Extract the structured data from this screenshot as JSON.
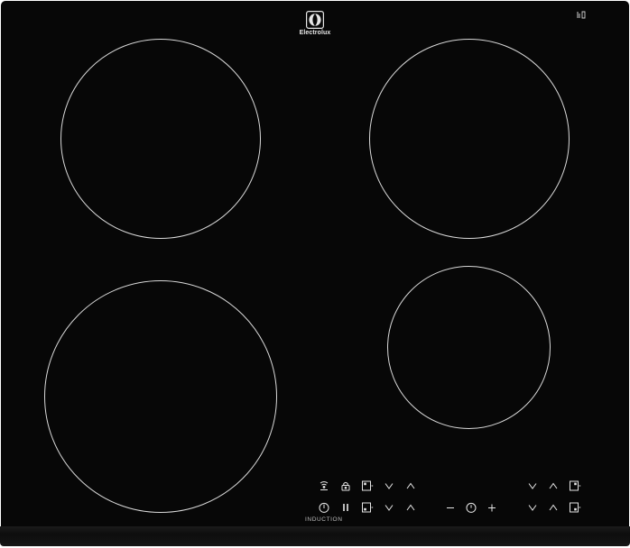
{
  "appliance": {
    "brand": "Electrolux",
    "type_label": "INDUCTION",
    "colors": {
      "glass": "#070707",
      "zone_outline": "#d9d9d9",
      "control_glyph": "#e6e6e6",
      "label_text": "#bdbdbd"
    }
  },
  "cooking_zones": [
    {
      "position": "rear-left"
    },
    {
      "position": "rear-right"
    },
    {
      "position": "front-left"
    },
    {
      "position": "front-right"
    }
  ],
  "controls": {
    "top_row": [
      {
        "icon": "hob2hood-icon"
      },
      {
        "icon": "lock-icon"
      },
      {
        "icon": "rear-left-zone-selector-icon"
      },
      {
        "icon": "chevron-down-icon"
      },
      {
        "icon": "chevron-up-icon"
      },
      {
        "icon": "chevron-down-icon"
      },
      {
        "icon": "chevron-up-icon"
      },
      {
        "icon": "rear-right-zone-selector-icon"
      }
    ],
    "bottom_row": [
      {
        "icon": "power-icon"
      },
      {
        "icon": "pause-icon"
      },
      {
        "icon": "front-left-zone-selector-icon"
      },
      {
        "icon": "chevron-down-icon"
      },
      {
        "icon": "chevron-up-icon"
      },
      {
        "icon": "minus-icon"
      },
      {
        "icon": "timer-icon"
      },
      {
        "icon": "plus-icon"
      },
      {
        "icon": "chevron-down-icon"
      },
      {
        "icon": "chevron-up-icon"
      },
      {
        "icon": "front-right-zone-selector-icon"
      }
    ],
    "status_icon": "bridge-icon"
  }
}
